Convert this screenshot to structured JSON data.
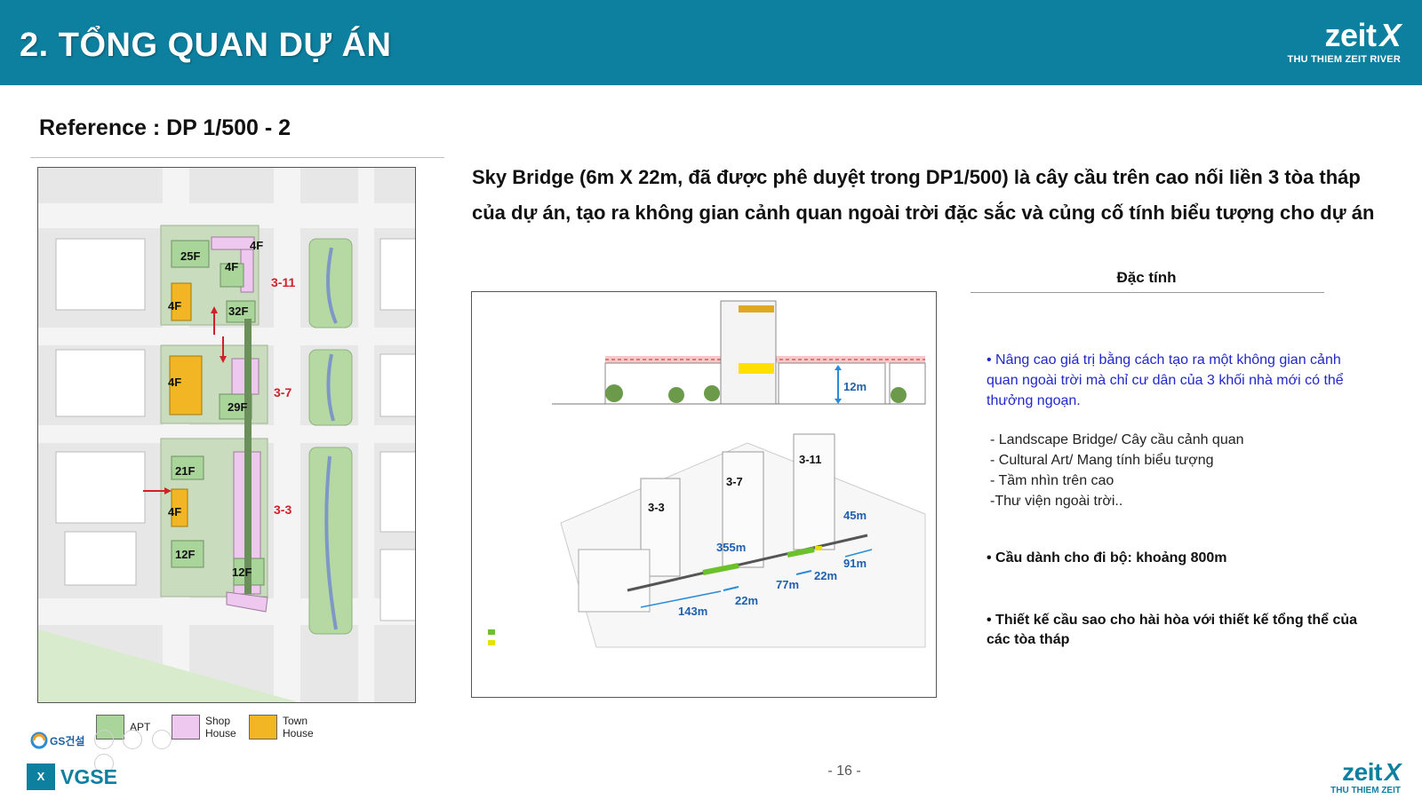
{
  "header": {
    "title": "2. TỔNG QUAN DỰ ÁN",
    "brand": "zeit",
    "brand_mark": "X",
    "brand_sub": "THU THIEM ZEIT RIVER",
    "bg_color": "#0d7f9f"
  },
  "reference": {
    "title": "Reference : DP 1/500 - 2"
  },
  "site_plan": {
    "floor_labels": [
      "4F",
      "25F",
      "4F",
      "4F",
      "32F",
      "4F",
      "29F",
      "21F",
      "4F",
      "12F",
      "12F"
    ],
    "block_labels": [
      "3-11",
      "3-7",
      "3-3"
    ]
  },
  "legend": {
    "items": [
      {
        "label_line1": "APT",
        "label_line2": "",
        "color": "#a9d49a"
      },
      {
        "label_line1": "Shop",
        "label_line2": "House",
        "color": "#eec8ee"
      },
      {
        "label_line1": "Town",
        "label_line2": "House",
        "color": "#f2b523"
      }
    ]
  },
  "description": "Sky Bridge (6m X 22m, đã được phê duyệt trong DP1/500) là cây cầu trên cao nối liền 3 tòa tháp của dự án, tạo ra không gian cảnh quan ngoài trời đặc sắc và củng cố tính biểu tượng cho dự án",
  "diagram": {
    "height_label": "12m",
    "tower_labels": [
      "3-3",
      "3-7",
      "3-11"
    ],
    "measurements": [
      "45m",
      "355m",
      "91m",
      "22m",
      "77m",
      "22m",
      "143m"
    ]
  },
  "properties": {
    "title": "Đặc tính",
    "lead": "• Nâng cao giá trị bằng cách tạo ra một không gian cảnh quan ngoài trời mà chỉ cư dân của 3 khối nhà mới có thể thưởng ngoạn.",
    "list": [
      "- Landscape Bridge/ Cây cầu cảnh quan",
      "- Cultural Art/ Mang tính biểu tượng",
      "- Tầm nhìn trên cao",
      "-Thư viện ngoài trời.."
    ],
    "walk": "• Cầu dành cho đi bộ: khoảng 800m",
    "design": "• Thiết kế cầu sao cho hài hòa với thiết kế tổng thể của các tòa tháp"
  },
  "footer": {
    "gs_logo": "GS건설",
    "vgse": "VGSE",
    "vgse_mark": "X",
    "page_number": "- 16 -",
    "brand": "zeit",
    "brand_mark": "X",
    "brand_sub": "THU THIEM ZEIT"
  }
}
